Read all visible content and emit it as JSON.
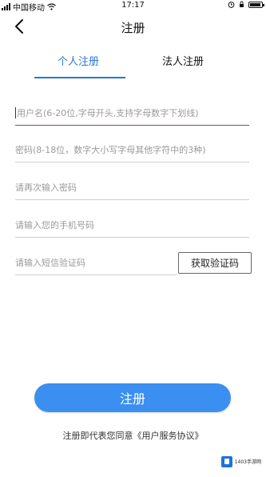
{
  "status_bar": {
    "carrier": "中国移动",
    "time": "17:17"
  },
  "header": {
    "title": "注册"
  },
  "tabs": [
    {
      "label": "个人注册",
      "active": true
    },
    {
      "label": "法人注册",
      "active": false
    }
  ],
  "form": {
    "username_placeholder": "用户名(6-20位,字母开头,支持字母数字下划线)",
    "password_placeholder": "密码(8-18位，数字大小写字母其他字符中的3种)",
    "confirm_placeholder": "请再次输入密码",
    "phone_placeholder": "请输入您的手机号码",
    "sms_placeholder": "请输入短信验证码",
    "get_code_label": "获取验证码"
  },
  "register_label": "注册",
  "agreement": {
    "prefix": "注册即代表您同意",
    "link": "《用户服务协议》"
  },
  "watermark": {
    "text": "1403手游网"
  },
  "colors": {
    "accent": "#2b74d6",
    "button": "#3b8ff0"
  }
}
